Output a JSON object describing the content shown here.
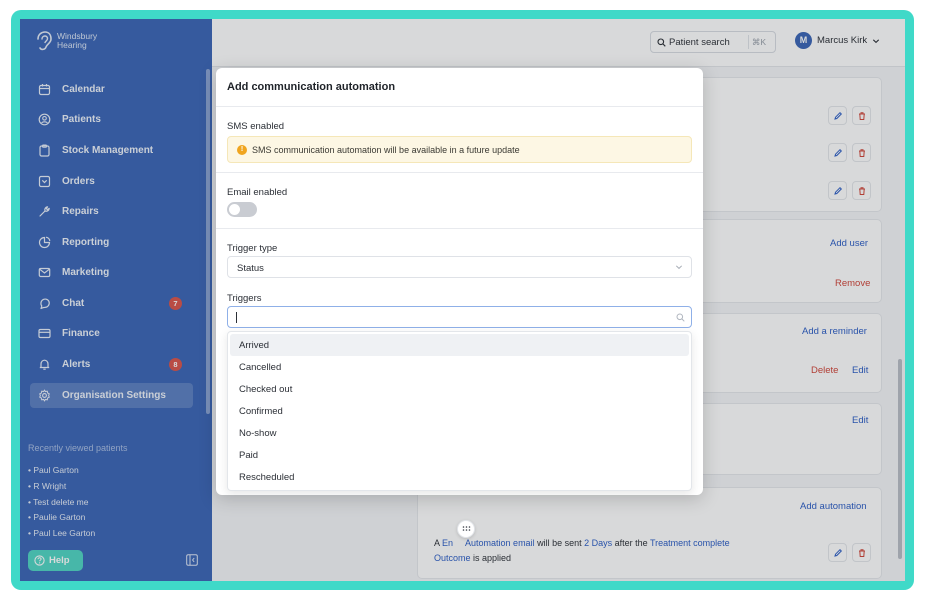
{
  "brand": {
    "name_line1": "Windsbury",
    "name_line2": "Hearing"
  },
  "sidebar": {
    "items": [
      {
        "label": "Calendar",
        "icon": "calendar-icon"
      },
      {
        "label": "Patients",
        "icon": "patients-icon"
      },
      {
        "label": "Stock Management",
        "icon": "stock-icon"
      },
      {
        "label": "Orders",
        "icon": "orders-icon"
      },
      {
        "label": "Repairs",
        "icon": "wrench-icon"
      },
      {
        "label": "Reporting",
        "icon": "chart-icon"
      },
      {
        "label": "Marketing",
        "icon": "mail-icon"
      },
      {
        "label": "Chat",
        "icon": "chat-icon",
        "badge": "7"
      },
      {
        "label": "Finance",
        "icon": "card-icon"
      },
      {
        "label": "Alerts",
        "icon": "bell-icon",
        "badge": "8"
      },
      {
        "label": "Organisation Settings",
        "icon": "gear-icon",
        "active": true
      }
    ],
    "recent_title": "Recently viewed patients",
    "recent": [
      "• Paul Garton",
      "• R Wright",
      "• Test delete me",
      "• Paulie Garton",
      "• Paul Lee Garton"
    ],
    "help_label": "Help"
  },
  "topbar": {
    "search_label": "Patient search",
    "search_shortcut": "⌘K",
    "user_initial": "M",
    "user_name": "Marcus Kirk"
  },
  "main": {
    "add_user": "Add user",
    "remove": "Remove",
    "add_reminder": "Add a reminder",
    "delete": "Delete",
    "edit": "Edit",
    "edit2": "Edit",
    "add_automation": "Add automation",
    "automation_sentence": {
      "p1": "A ",
      "p2": "En",
      "p3": "Automation email",
      "p4": " will be sent ",
      "p5": "2 Days",
      "p6": " after the ",
      "p7": "Treatment complete",
      "p8": "Outcome",
      "p9": " is applied"
    }
  },
  "modal": {
    "title": "Add communication automation",
    "sms_label": "SMS enabled",
    "sms_notice": "SMS communication automation will be available in a future update",
    "email_label": "Email enabled",
    "email_enabled": false,
    "trigger_type_label": "Trigger type",
    "trigger_type_value": "Status",
    "triggers_label": "Triggers",
    "triggers_input": "",
    "options": [
      "Arrived",
      "Cancelled",
      "Checked out",
      "Confirmed",
      "No-show",
      "Paid",
      "Rescheduled"
    ]
  },
  "colors": {
    "sidebar_bg": "#3a65b6",
    "accent": "#2a5cc5",
    "danger": "#d04438",
    "frame": "#3fd9c8",
    "warning": "#f0a51f"
  }
}
